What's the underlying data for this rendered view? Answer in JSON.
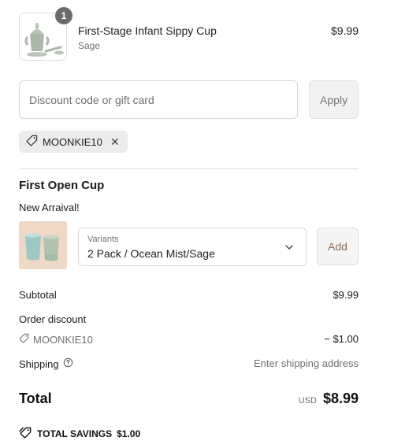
{
  "line_item": {
    "quantity_badge": "1",
    "title": "First-Stage Infant Sippy Cup",
    "variant": "Sage",
    "price": "$9.99"
  },
  "discount": {
    "placeholder": "Discount code or gift card",
    "value": "",
    "apply_label": "Apply",
    "applied_code": "MOONKIE10"
  },
  "upsell": {
    "title": "First Open Cup",
    "subtitle": "New Arraival!",
    "variants_label": "Variants",
    "selected_variant": "2 Pack / Ocean Mist/Sage",
    "add_label": "Add"
  },
  "summary": {
    "subtotal_label": "Subtotal",
    "subtotal_value": "$9.99",
    "order_discount_label": "Order discount",
    "discount_code": "MOONKIE10",
    "discount_value": "− $1.00",
    "shipping_label": "Shipping",
    "shipping_value": "Enter shipping address",
    "total_label": "Total",
    "currency": "USD",
    "total_value": "$8.99",
    "savings_label": "TOTAL SAVINGS",
    "savings_value": "$1.00"
  },
  "colors": {
    "badge": "#6b6b6b",
    "chip_bg": "#ececec",
    "add_text": "#8a6b55",
    "cup_sage": "#a9b8a8"
  },
  "icons": [
    "tag-icon",
    "close-icon",
    "chevron-down-icon",
    "info-icon",
    "savings-tag-icon"
  ]
}
